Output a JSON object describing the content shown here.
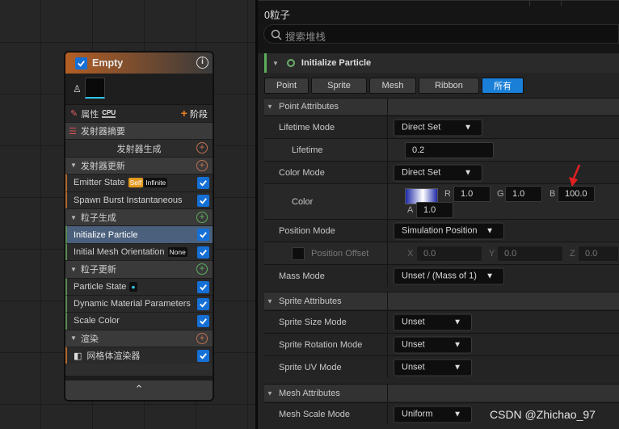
{
  "node": {
    "title": "Empty",
    "info": "i",
    "properties_label": "属性",
    "cpu_badge": "CPU",
    "stage_label": "阶段",
    "stage_plus": "+",
    "summary_label": "发射器摘要",
    "spawn_label": "发射器生成",
    "update_section": "发射器更新",
    "emitter_state": "Emitter State",
    "self_badge": "Self",
    "infinite_badge": "Infinite",
    "spawn_burst": "Spawn Burst Instantaneous",
    "particle_spawn_section": "粒子生成",
    "initialize_particle": "Initialize Particle",
    "initial_mesh_orientation": "Initial Mesh Orientation",
    "none_badge": "None",
    "particle_update_section": "粒子更新",
    "particle_state": "Particle State",
    "dynamic_material": "Dynamic Material Parameters",
    "scale_color": "Scale Color",
    "render_section": "渲染",
    "mesh_renderer": "网格体渲染器",
    "collapse": "⌃"
  },
  "panel": {
    "count": "0粒子",
    "search_placeholder": "搜索堆栈",
    "group_title": "Initialize Particle",
    "tabs": [
      "Point",
      "Sprite",
      "Mesh",
      "Ribbon",
      "所有"
    ],
    "point_attributes": "Point Attributes",
    "lifetime_mode": "Lifetime Mode",
    "lifetime_mode_value": "Direct Set",
    "lifetime": "Lifetime",
    "lifetime_value": "0.2",
    "color_mode": "Color Mode",
    "color_mode_value": "Direct Set",
    "color": "Color",
    "r": "R",
    "r_val": "1.0",
    "g": "G",
    "g_val": "1.0",
    "b": "B",
    "b_val": "100.0",
    "a": "A",
    "a_val": "1.0",
    "position_mode": "Position Mode",
    "position_mode_value": "Simulation Position",
    "position_offset": "Position Offset",
    "x": "X",
    "x_val": "0.0",
    "y": "Y",
    "y_val": "0.0",
    "z": "Z",
    "z_val": "0.0",
    "mass_mode": "Mass Mode",
    "mass_mode_value": "Unset / (Mass of 1)",
    "sprite_attributes": "Sprite Attributes",
    "sprite_size_mode": "Sprite Size Mode",
    "sprite_size_value": "Unset",
    "sprite_rotation_mode": "Sprite Rotation Mode",
    "sprite_rotation_value": "Unset",
    "sprite_uv_mode": "Sprite UV Mode",
    "sprite_uv_value": "Unset",
    "mesh_attributes": "Mesh Attributes",
    "mesh_scale_mode": "Mesh Scale Mode",
    "mesh_scale_value": "Uniform"
  },
  "watermark": "CSDN @Zhichao_97",
  "colors": {
    "accent_blue": "#1a7fd7",
    "node_header": "#b35e24",
    "selected_row": "#4a607c",
    "module_green": "#5cae5c",
    "annotation_red": "#e02020"
  }
}
